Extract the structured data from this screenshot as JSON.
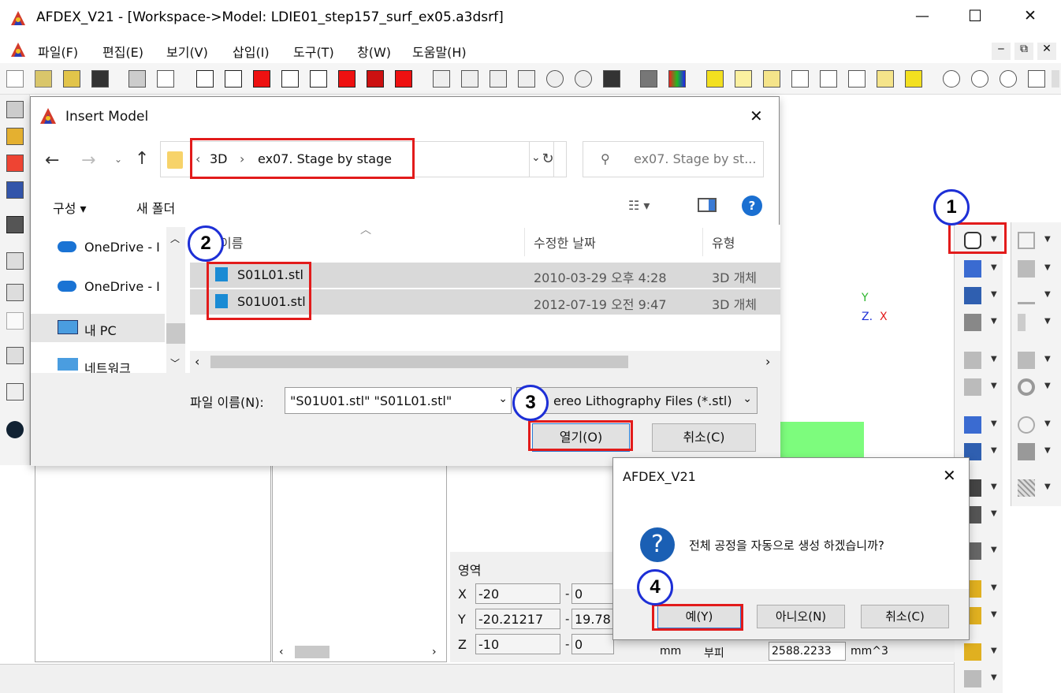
{
  "window": {
    "title": "AFDEX_V21 - [Workspace->Model: LDIE01_step157_surf_ex05.a3dsrf]",
    "minimize": "—",
    "maximize": "☐",
    "close": "✕"
  },
  "menu": {
    "items": [
      "파일(F)",
      "편집(E)",
      "보기(V)",
      "삽입(I)",
      "도구(T)",
      "창(W)",
      "도움말(H)"
    ],
    "mdi_min": "‒",
    "mdi_restore": "⧉",
    "mdi_close": "✕"
  },
  "dialog": {
    "title": "Insert Model",
    "close": "✕",
    "breadcrumb": {
      "sep0": "‹",
      "part1": "3D",
      "sep1": "›",
      "part2": "ex07. Stage by stage"
    },
    "search_placeholder": "ex07. Stage by st...",
    "organize": "구성 ▾",
    "new_folder": "새 폴더",
    "nav_items": [
      "OneDrive - I",
      "OneDrive - I",
      "내 PC",
      "네트워크"
    ],
    "columns": {
      "name": "이름",
      "date": "수정한 날짜",
      "type": "유형"
    },
    "files": [
      {
        "name": "S01L01.stl",
        "date": "2010-03-29 오후 4:28",
        "type": "3D 개체"
      },
      {
        "name": "S01U01.stl",
        "date": "2012-07-19 오전 9:47",
        "type": "3D 개체"
      }
    ],
    "filename_label": "파일 이름(N):",
    "filename_value": "\"S01U01.stl\" \"S01L01.stl\"",
    "filetype": "ereo Lithography Files (*.stl)",
    "open_button": "열기(O)",
    "cancel_button": "취소(C)"
  },
  "msgbox": {
    "title": "AFDEX_V21",
    "close": "✕",
    "question_mark": "?",
    "message": "전체 공정을 자동으로 생성 하겠습니까?",
    "yes": "예(Y)",
    "no": "아니오(N)",
    "cancel": "취소(C)"
  },
  "region_panel": {
    "title": "영역",
    "rows": [
      {
        "axis": "X",
        "min": "-20",
        "max": "0"
      },
      {
        "axis": "Y",
        "min": "-20.21217",
        "max": "19.78"
      },
      {
        "axis": "Z",
        "min": "-10",
        "max": "0"
      }
    ],
    "dash": "-",
    "unit_text": "mm",
    "volume_label": "부피",
    "volume_value": "2588.2233",
    "volume_unit": "mm^3"
  },
  "axis_triad": {
    "y": "Y",
    "z": "Z.",
    "x": "X"
  },
  "callouts": [
    "1",
    "2",
    "3",
    "4"
  ],
  "colors": {
    "callout_red": "#e21b1b",
    "callout_blue": "#1d2fd6",
    "green_block": "#7dfc7d",
    "question_blue": "#1a5fb4"
  }
}
